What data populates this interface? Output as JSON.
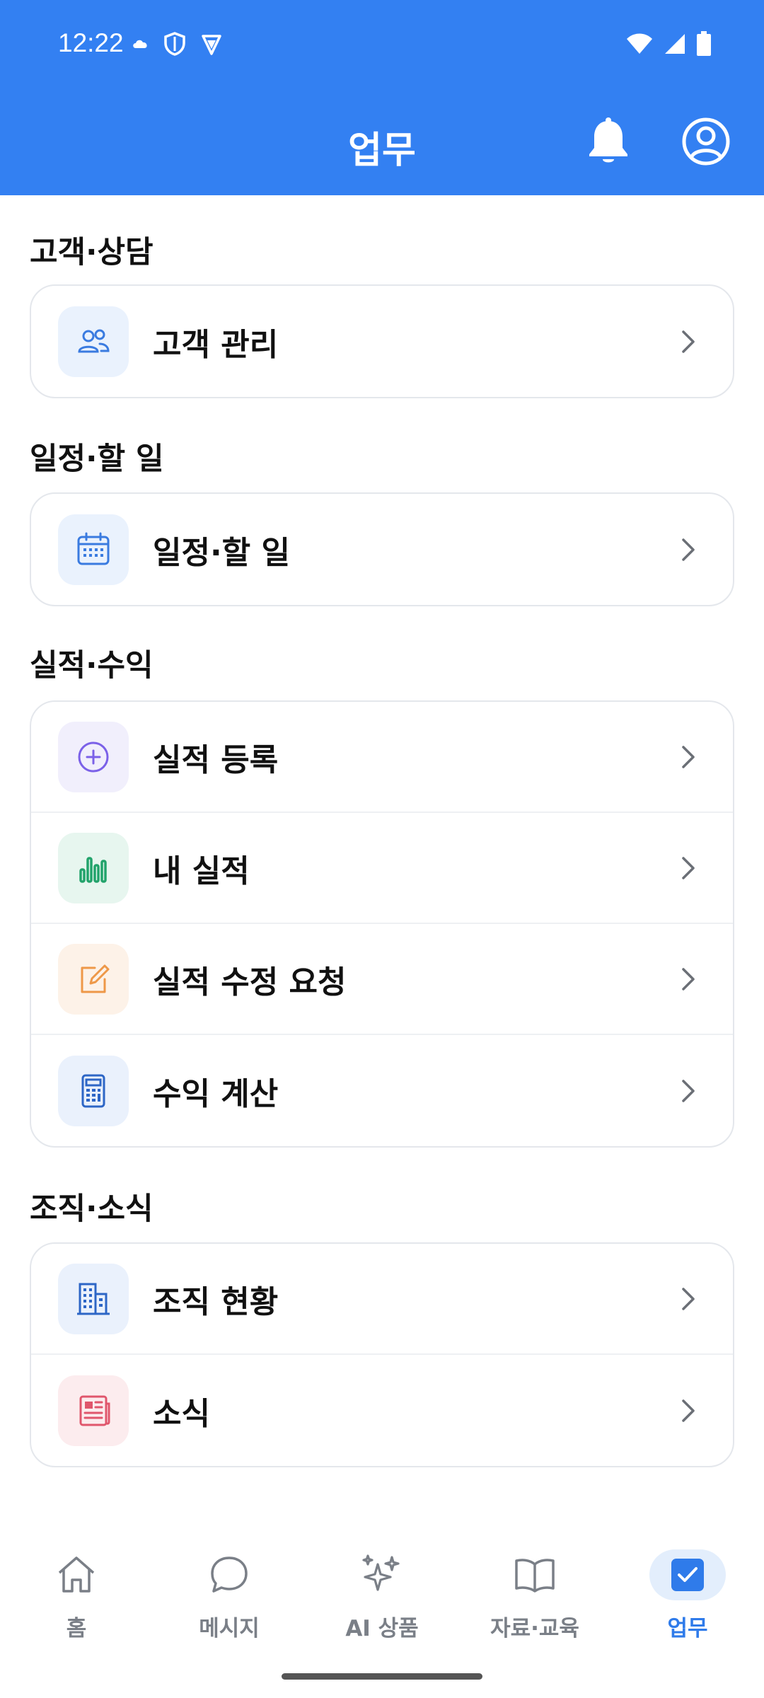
{
  "status_bar": {
    "time": "12:22",
    "left_icons": [
      "cloud-icon",
      "shield-icon",
      "vpn-shield-icon"
    ],
    "right_icons": [
      "wifi-icon",
      "signal-icon",
      "battery-icon"
    ]
  },
  "header": {
    "title": "업무",
    "background": "#3380F2",
    "buttons": [
      "bell-icon",
      "profile-icon"
    ]
  },
  "sections": [
    {
      "title": "고객·상담",
      "items": [
        {
          "label": "고객 관리",
          "icon": "users-icon",
          "icon_color": "#3A7BE0",
          "icon_bg": "#EAF2FD"
        }
      ]
    },
    {
      "title": "일정·할 일",
      "items": [
        {
          "label": "일정·할 일",
          "icon": "calendar-icon",
          "icon_color": "#3A7BE0",
          "icon_bg": "#EAF2FD"
        }
      ]
    },
    {
      "title": "실적·수익",
      "items": [
        {
          "label": "실적 등록",
          "icon": "plus-circle-icon",
          "icon_color": "#7B61E8",
          "icon_bg": "#F1EFFC"
        },
        {
          "label": "내 실적",
          "icon": "bar-chart-icon",
          "icon_color": "#22A36B",
          "icon_bg": "#E7F6EF"
        },
        {
          "label": "실적 수정 요청",
          "icon": "edit-icon",
          "icon_color": "#EE9848",
          "icon_bg": "#FDF2E8"
        },
        {
          "label": "수익 계산",
          "icon": "calculator-icon",
          "icon_color": "#2D66C6",
          "icon_bg": "#EAF1FC"
        }
      ]
    },
    {
      "title": "조직·소식",
      "items": [
        {
          "label": "조직 현황",
          "icon": "building-icon",
          "icon_color": "#2D66C6",
          "icon_bg": "#EAF1FC"
        },
        {
          "label": "소식",
          "icon": "newspaper-icon",
          "icon_color": "#E0566C",
          "icon_bg": "#FCECEE"
        }
      ]
    }
  ],
  "bottom_nav": {
    "items": [
      {
        "label": "홈",
        "icon": "home-icon"
      },
      {
        "label": "메시지",
        "icon": "message-icon"
      },
      {
        "label": "AI 상품",
        "icon": "sparkle-icon"
      },
      {
        "label": "자료·교육",
        "icon": "book-icon"
      },
      {
        "label": "업무",
        "icon": "checkbox-icon"
      }
    ],
    "active": "업무",
    "active_color": "#2F7BEA"
  }
}
